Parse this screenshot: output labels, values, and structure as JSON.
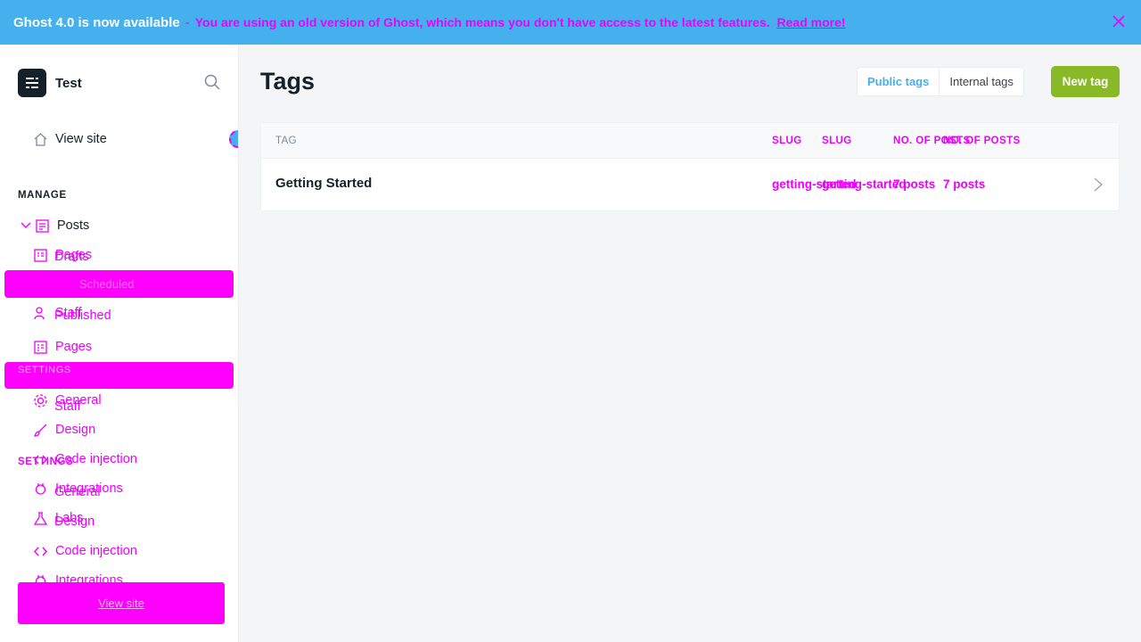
{
  "banner": {
    "title": "Ghost 4.0 is now available",
    "separator": "-",
    "message": "You are using an old version of Ghost, which means you don't have access to the latest features.",
    "link": "Read more!"
  },
  "sidebar": {
    "site_name": "Test",
    "view_site": "View site",
    "manage_label": "MANAGE",
    "settings_label": "SETTINGS",
    "items": {
      "posts": "Posts",
      "pages_ghost": "Pages",
      "drafts": "Drafts",
      "scheduled": "Scheduled",
      "staff_ghost": "Staff",
      "published": "Published",
      "pages": "Pages",
      "settings_ghost": "SETTINGS",
      "general": "General",
      "staff": "Staff",
      "design": "Design",
      "code_injection": "Code injection",
      "integrations": "Integrations",
      "labs": "Labs",
      "general2": "General",
      "design2": "Design",
      "code_injection2": "Code injection",
      "integrations2": "Integrations"
    },
    "footer_link": "View site"
  },
  "main": {
    "title": "Tags",
    "toggle": {
      "public": "Public tags",
      "internal": "Internal tags"
    },
    "new_tag": "New tag",
    "columns": {
      "tag": "TAG",
      "slug": "SLUG",
      "posts": "NO. OF POSTS"
    },
    "rows": [
      {
        "name": "Getting Started",
        "slug": "getting-started",
        "posts": "7 posts"
      }
    ]
  },
  "colors": {
    "accent": "#45b0ee",
    "brand": "#89b926",
    "overlay": "#ff00ff"
  }
}
